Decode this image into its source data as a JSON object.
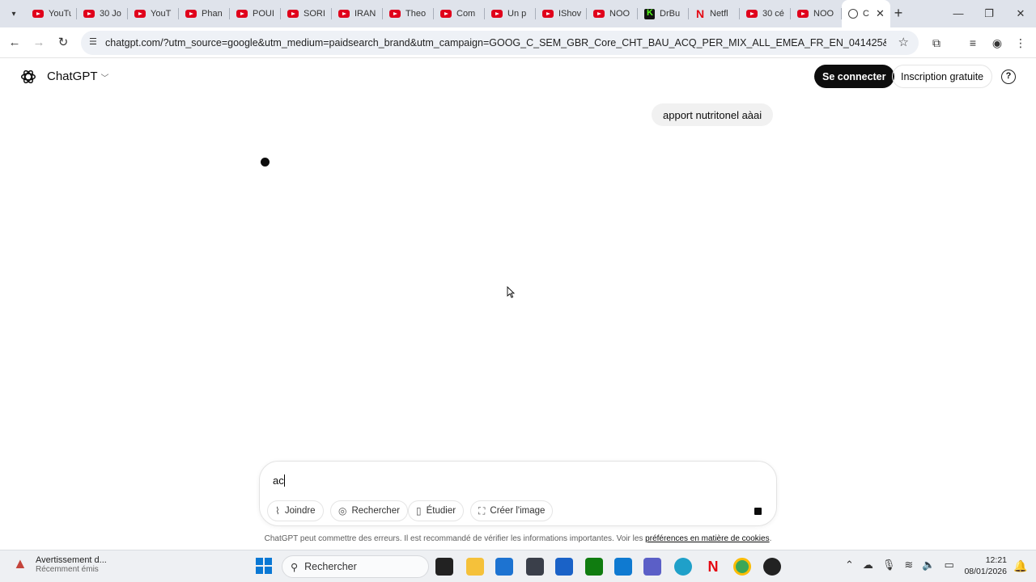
{
  "browser": {
    "tabs": [
      {
        "label": "YouTu",
        "icon": "youtube-icon"
      },
      {
        "label": "30 Jo",
        "icon": "youtube-icon"
      },
      {
        "label": "YouT",
        "icon": "youtube-icon"
      },
      {
        "label": "Phan",
        "icon": "youtube-icon"
      },
      {
        "label": "POUI",
        "icon": "youtube-icon"
      },
      {
        "label": "SORI",
        "icon": "youtube-icon"
      },
      {
        "label": "IRAN",
        "icon": "youtube-icon"
      },
      {
        "label": "Theo",
        "icon": "youtube-icon"
      },
      {
        "label": "Com",
        "icon": "youtube-icon"
      },
      {
        "label": "Un p",
        "icon": "youtube-icon"
      },
      {
        "label": "IShov",
        "icon": "youtube-icon"
      },
      {
        "label": "NOO",
        "icon": "youtube-icon"
      },
      {
        "label": "DrBu",
        "icon": "kick-icon"
      },
      {
        "label": "Netfl",
        "icon": "netflix-icon"
      },
      {
        "label": "30 cé",
        "icon": "youtube-icon"
      },
      {
        "label": "NOO",
        "icon": "youtube-icon"
      },
      {
        "label": "C",
        "icon": "chatgpt-icon",
        "active": true
      }
    ],
    "url": "chatgpt.com/?utm_source=google&utm_medium=paidsearch_brand&utm_campaign=GOOG_C_SEM_GBR_Core_CHT_BAU_ACQ_PER_MIX_ALL_EMEA_FR_EN_041425&utm_term=chatgpt..."
  },
  "page": {
    "model_name": "ChatGPT",
    "login_label": "Se connecter",
    "signup_label": "Inscription gratuite",
    "user_message": "apport nutritonel aàai",
    "composer": {
      "text": "ac",
      "attach_label": "Joindre",
      "search_label": "Rechercher",
      "study_label": "Étudier",
      "image_label": "Créer l'image"
    },
    "disclaimer_text": "ChatGPT peut commettre des erreurs. Il est recommandé de vérifier les informations importantes. Voir les ",
    "disclaimer_link": "préférences en matière de cookies",
    "disclaimer_end": "."
  },
  "taskbar": {
    "notification_title": "Avertissement d...",
    "notification_subtitle": "Récemment émis",
    "search_placeholder": "Rechercher",
    "time": "12:21",
    "date": "08/01/2026"
  },
  "colors": {
    "youtube_red": "#e0001b",
    "button_dark": "#0d0d0d",
    "tabstrip_bg": "#dfe3eb",
    "windows_blue": "#0a78d4"
  }
}
